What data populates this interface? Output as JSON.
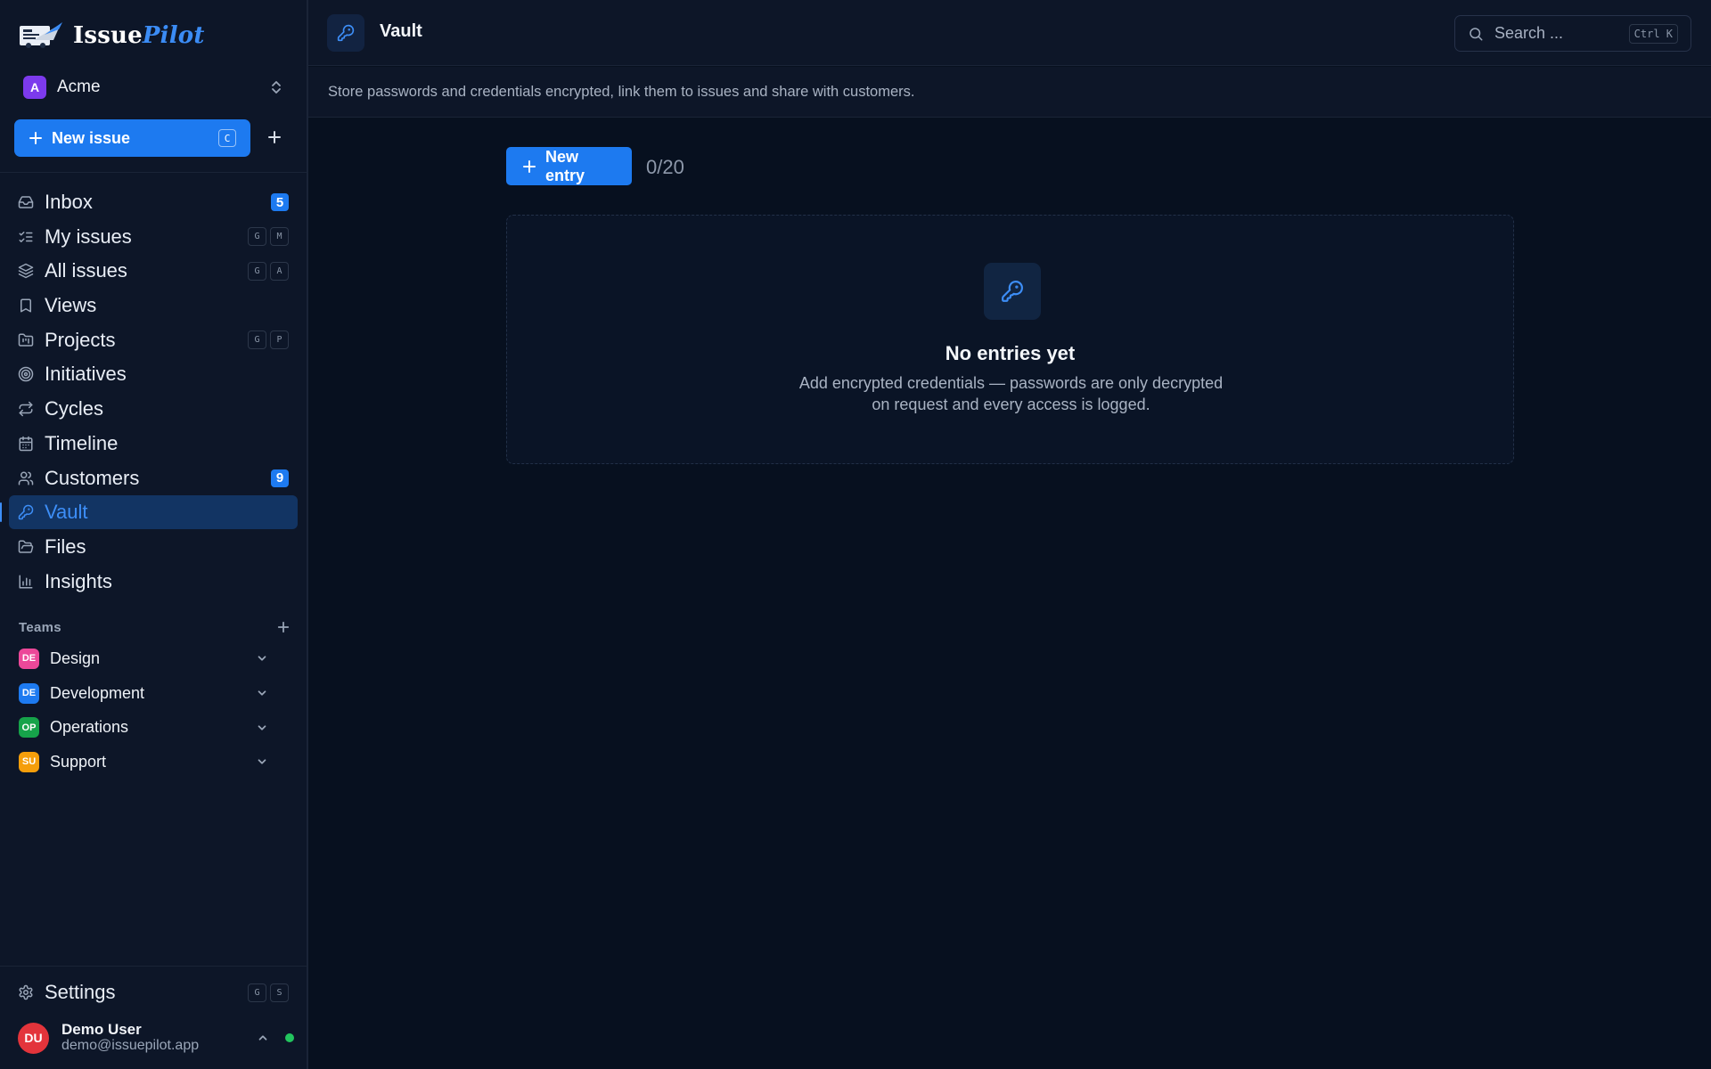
{
  "app": {
    "name_part1": "Issue",
    "name_part2": "Pilot"
  },
  "workspace": {
    "initial": "A",
    "name": "Acme"
  },
  "new_issue": {
    "label": "New issue",
    "shortcut": "C"
  },
  "nav": [
    {
      "label": "Inbox",
      "icon": "inbox-icon",
      "badge": "5"
    },
    {
      "label": "My issues",
      "icon": "list-checks-icon",
      "keys": [
        "G",
        "M"
      ]
    },
    {
      "label": "All issues",
      "icon": "layers-icon",
      "keys": [
        "G",
        "A"
      ]
    },
    {
      "label": "Views",
      "icon": "bookmark-icon"
    },
    {
      "label": "Projects",
      "icon": "folder-kanban-icon",
      "keys": [
        "G",
        "P"
      ]
    },
    {
      "label": "Initiatives",
      "icon": "target-icon"
    },
    {
      "label": "Cycles",
      "icon": "repeat-icon"
    },
    {
      "label": "Timeline",
      "icon": "calendar-icon"
    },
    {
      "label": "Customers",
      "icon": "users-icon",
      "badge": "9"
    },
    {
      "label": "Vault",
      "icon": "key-icon",
      "active": true
    },
    {
      "label": "Files",
      "icon": "folder-open-icon"
    },
    {
      "label": "Insights",
      "icon": "bar-chart-icon"
    }
  ],
  "teams": {
    "title": "Teams",
    "items": [
      {
        "initials": "DE",
        "name": "Design",
        "color": "#ec4899"
      },
      {
        "initials": "DE",
        "name": "Development",
        "color": "#1d7af0"
      },
      {
        "initials": "OP",
        "name": "Operations",
        "color": "#16a34a"
      },
      {
        "initials": "SU",
        "name": "Support",
        "color": "#f59e0b"
      }
    ]
  },
  "settings": {
    "label": "Settings",
    "keys": [
      "G",
      "S"
    ]
  },
  "user": {
    "initials": "DU",
    "name": "Demo User",
    "email": "demo@issuepilot.app"
  },
  "header": {
    "title": "Vault",
    "search_placeholder": "Search ...",
    "search_shortcut": "Ctrl K",
    "description": "Store passwords and credentials encrypted, link them to issues and share with customers."
  },
  "main": {
    "new_entry_label": "New entry",
    "count": "0/20",
    "empty_title": "No entries yet",
    "empty_desc_line1": "Add encrypted credentials — passwords are only decrypted",
    "empty_desc_line2": "on request and every access is logged."
  },
  "colors": {
    "accent": "#1d7af0",
    "active_bg": "#123463",
    "background": "#07101f",
    "sidebar": "#0d1628"
  }
}
